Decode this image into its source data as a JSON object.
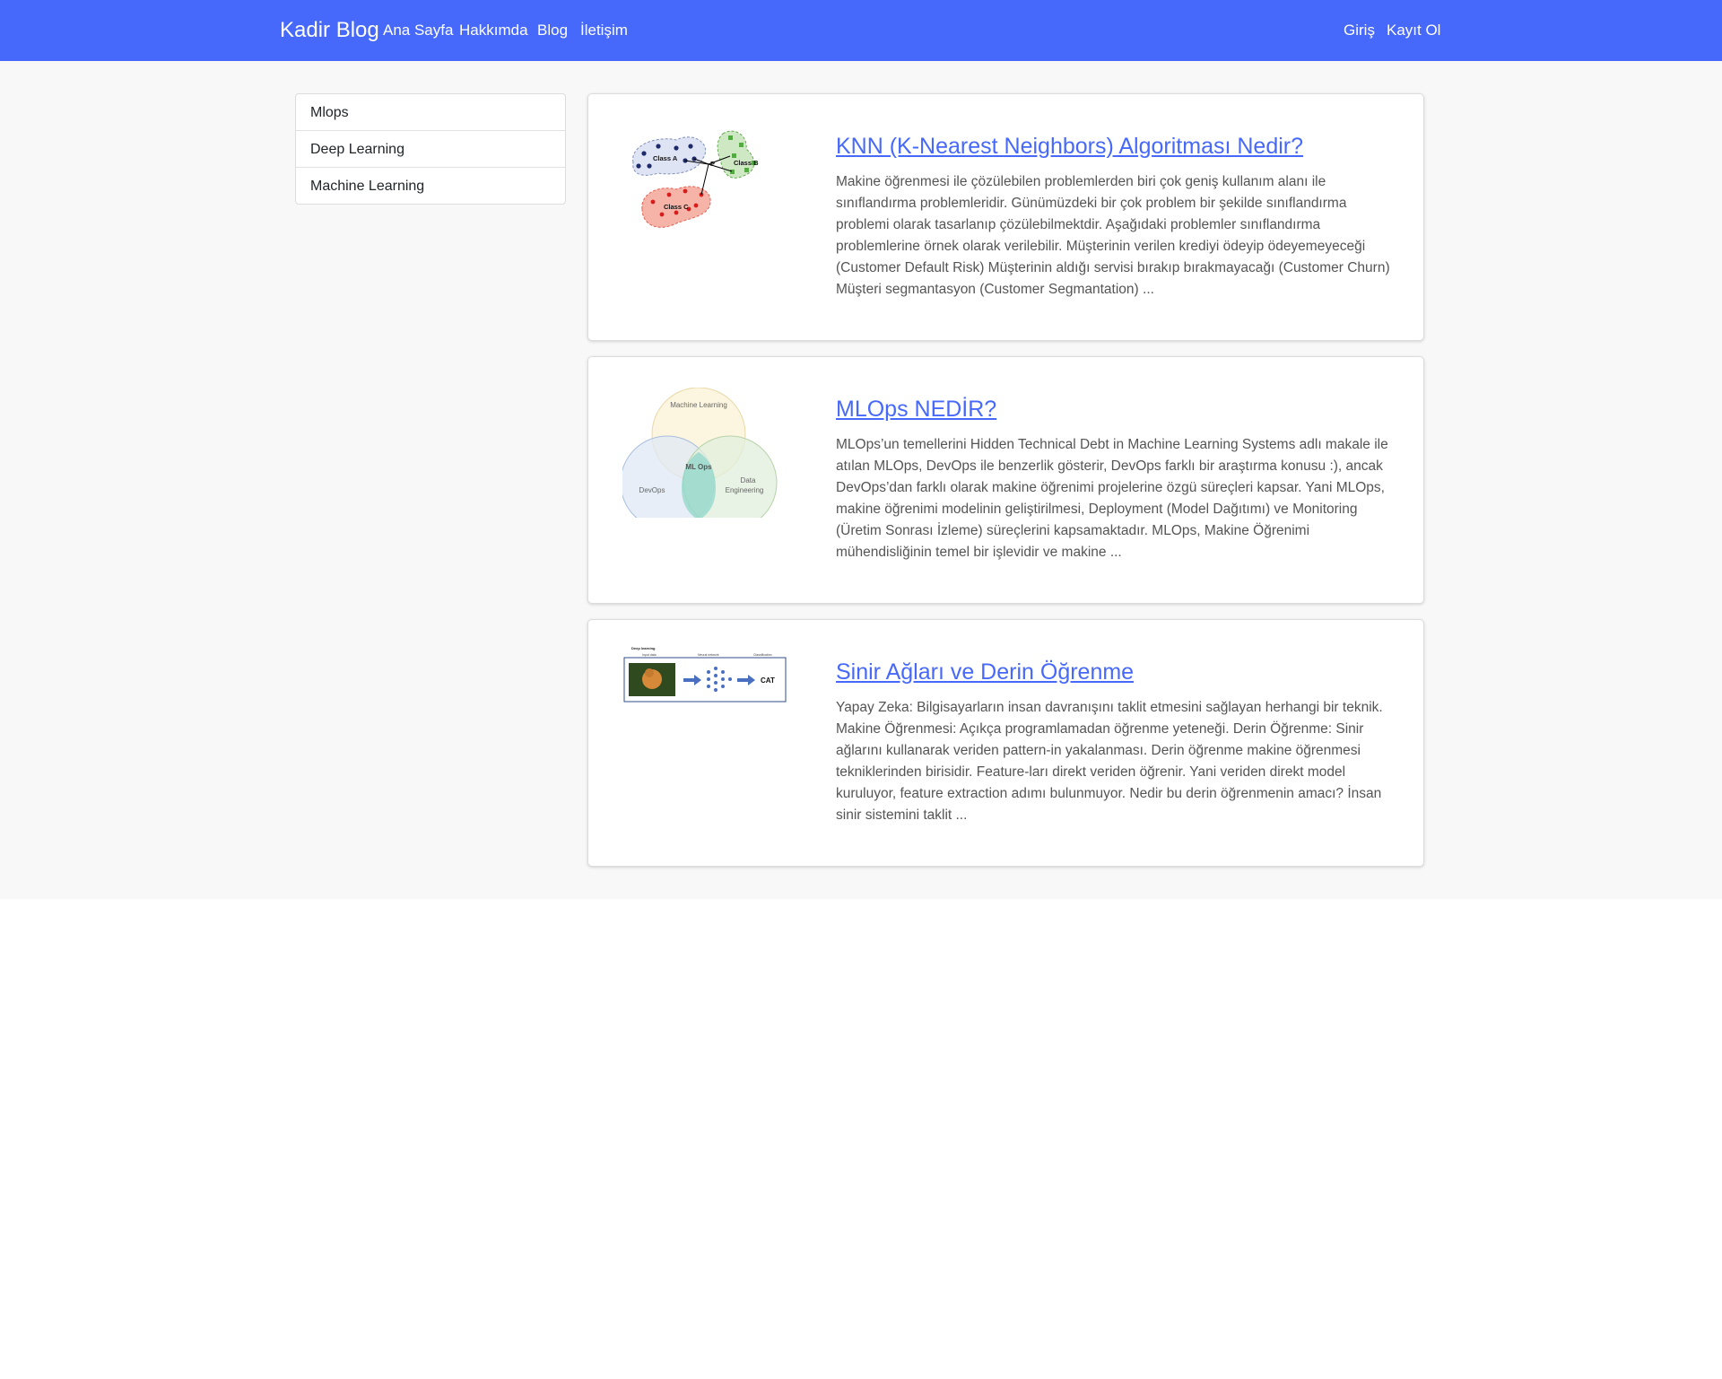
{
  "navbar": {
    "brand": "Kadir Blog",
    "links": [
      "Ana Sayfa",
      "Hakkımda",
      "Blog",
      "İletişim"
    ],
    "auth": [
      "Giriş",
      "Kayıt Ol"
    ],
    "bg_color": "#4769fb"
  },
  "sidebar": {
    "categories": [
      "Mlops",
      "Deep Learning",
      "Machine Learning"
    ]
  },
  "posts": [
    {
      "title": "KNN (K-Nearest Neighbors) Algoritması Nedir?",
      "excerpt": "Makine öğrenmesi ile çözülebilen problemlerden biri çok geniş kullanım alanı ile sınıflandırma problemleridir. Günümüzdeki bir çok problem bir şekilde sınıflandırma problemi olarak tasarlanıp çözülebilmektdir. Aşağıdaki problemler sınıflandırma problemlerine örnek olarak verilebilir. Müşterinin verilen krediyi ödeyip ödeyemeyeceği (Customer Default Risk) Müşterinin aldığı servisi bırakıp bırakmayacağı (Customer Churn) Müşteri segmantasyon (Customer Segmantation) ...",
      "thumb_labels": [
        "Class A",
        "Class B",
        "Class C",
        "P"
      ]
    },
    {
      "title": "MLOps NEDİR?",
      "excerpt": "MLOps’un temellerini Hidden Technical Debt in Machine Learning Systems adlı makale ile atılan MLOps, DevOps ile benzerlik gösterir, DevOps farklı bir araştırma konusu :), ancak DevOps’dan farklı olarak makine öğrenimi projelerine özgü süreçleri kapsar. Yani MLOps, makine öğrenimi modelinin geliştirilmesi, Deployment (Model Dağıtımı) ve Monitoring (Üretim Sonrası İzleme) süreçlerini kapsamaktadır. MLOps, Makine Öğrenimi mühendisliğinin temel bir işlevidir ve makine ...",
      "thumb_labels": [
        "Machine Learning",
        "ML Ops",
        "DevOps",
        "Data",
        "Engineering"
      ]
    },
    {
      "title": "Sinir Ağları ve Derin Öğrenme",
      "excerpt": "Yapay Zeka: Bilgisayarların insan davranışını taklit etmesini sağlayan herhangi bir teknik. Makine Öğrenmesi: Açıkça programlamadan öğrenme yeteneği. Derin Öğrenme: Sinir ağlarını kullanarak veriden pattern-in yakalanması. Derin öğrenme makine öğrenmesi tekniklerinden birisidir. Feature-ları direkt veriden öğrenir. Yani veriden direkt model kuruluyor, feature extraction adımı bulunmuyor. Nedir bu derin öğrenmenin amacı? İnsan sinir sistemini taklit ...",
      "thumb_labels": [
        "Deep learning",
        "Input data",
        "Neural network",
        "Classification",
        "CAT"
      ]
    }
  ]
}
